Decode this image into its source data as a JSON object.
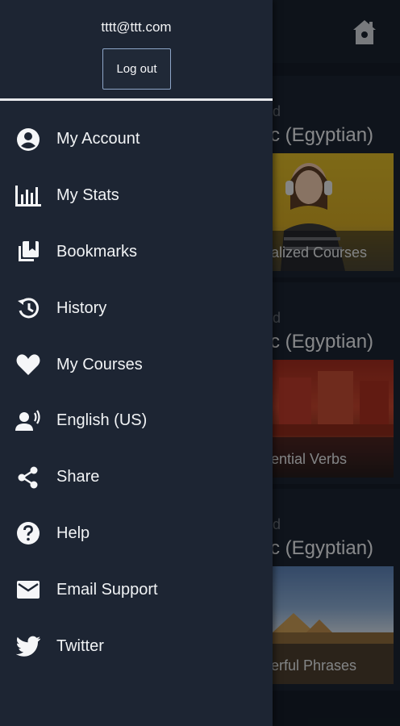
{
  "drawer": {
    "user_email": "tttt@ttt.com",
    "logout_label": "Log out",
    "items": [
      {
        "label": "My Account",
        "icon": "account-circle-icon"
      },
      {
        "label": "My Stats",
        "icon": "bar-chart-icon"
      },
      {
        "label": "Bookmarks",
        "icon": "bookmarks-icon"
      },
      {
        "label": "History",
        "icon": "history-icon"
      },
      {
        "label": "My Courses",
        "icon": "heart-icon"
      },
      {
        "label": "English (US)",
        "icon": "voice-language-icon"
      },
      {
        "label": "Share",
        "icon": "share-icon"
      },
      {
        "label": "Help",
        "icon": "help-icon"
      },
      {
        "label": "Email Support",
        "icon": "email-icon"
      },
      {
        "label": "Twitter",
        "icon": "twitter-icon"
      }
    ]
  },
  "background": {
    "home_icon": "home-icon",
    "cards": [
      {
        "level": "d",
        "language": "c (Egyptian)",
        "caption": "alized Courses"
      },
      {
        "level": "d",
        "language": "c (Egyptian)",
        "caption": "ential Verbs"
      },
      {
        "level": "d",
        "language": "c (Egyptian)",
        "caption": "erful Phrases"
      }
    ]
  },
  "colors": {
    "drawer_bg": "#1d2533",
    "background_app": "#151d28",
    "logout_border": "#8ea6c8",
    "text": "#f1f3f5"
  }
}
